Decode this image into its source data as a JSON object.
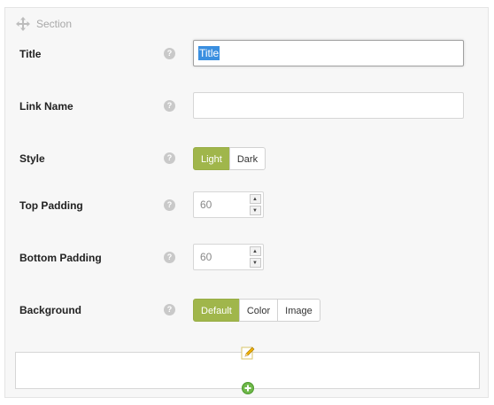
{
  "section": {
    "label": "Section",
    "icon": "move-icon"
  },
  "fields": {
    "title": {
      "label": "Title",
      "value": "Title",
      "help": "?"
    },
    "link_name": {
      "label": "Link Name",
      "value": "",
      "help": "?"
    },
    "style": {
      "label": "Style",
      "help": "?",
      "options": [
        "Light",
        "Dark"
      ],
      "selected": "Light"
    },
    "top_padding": {
      "label": "Top Padding",
      "value": "60",
      "help": "?"
    },
    "bottom_padding": {
      "label": "Bottom Padding",
      "value": "60",
      "help": "?"
    },
    "background": {
      "label": "Background",
      "help": "?",
      "options": [
        "Default",
        "Color",
        "Image"
      ],
      "selected": "Default"
    }
  },
  "colors": {
    "accent": "#a0b64b",
    "selection": "#3a8fe0"
  },
  "icons": {
    "edit": "pencil-icon",
    "add": "add-circle-icon",
    "help": "help-icon"
  }
}
